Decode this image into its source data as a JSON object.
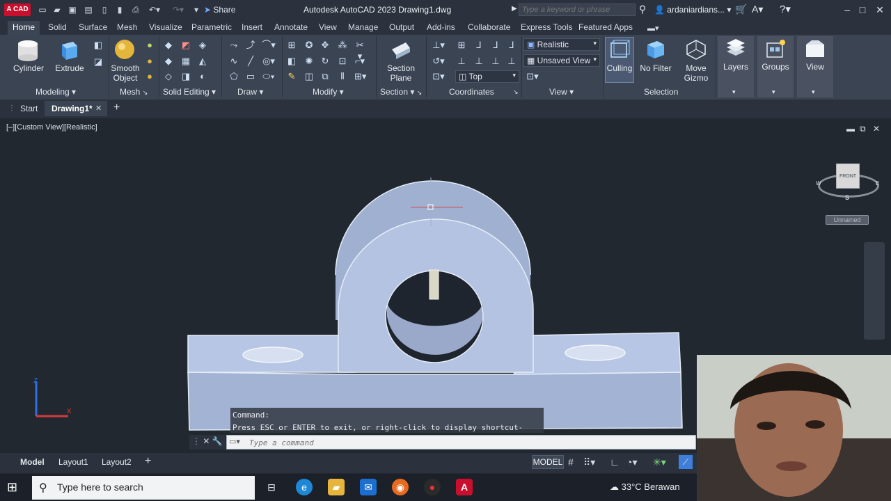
{
  "titlebar": {
    "logo": "A CAD",
    "share": "Share",
    "title": "Autodesk AutoCAD 2023    Drawing1.dwg",
    "search_placeholder": "Type a keyword or phrase",
    "user": "ardaniardians..."
  },
  "tabs": [
    "Home",
    "Solid",
    "Surface",
    "Mesh",
    "Visualize",
    "Parametric",
    "Insert",
    "Annotate",
    "View",
    "Manage",
    "Output",
    "Add-ins",
    "Collaborate",
    "Express Tools",
    "Featured Apps"
  ],
  "ribbon": {
    "cylinder": "Cylinder",
    "extrude": "Extrude",
    "smooth_object": "Smooth\nObject",
    "section_plane": "Section\nPlane",
    "visual_style": "Realistic",
    "view_name": "Unsaved View",
    "ucs_view": "Top",
    "culling": "Culling",
    "no_filter": "No Filter",
    "move_gizmo": "Move\nGizmo",
    "layers": "Layers",
    "groups": "Groups",
    "view": "View",
    "panels": [
      "Modeling",
      "Mesh",
      "Solid Editing",
      "Draw",
      "Modify",
      "Section",
      "Coordinates",
      "View",
      "Selection"
    ]
  },
  "filetabs": {
    "start": "Start",
    "drawing": "Drawing1*"
  },
  "viewport": {
    "label": "[–][Custom View][Realistic]",
    "cube_face": "FRONT",
    "cube_w": "W",
    "cube_e": "E",
    "cube_s": "S",
    "named_view": "Unnamed"
  },
  "command": {
    "history_1": "Command:",
    "history_2": "Press ESC or ENTER to exit, or right-click to display shortcut-menu.",
    "placeholder": "Type a command"
  },
  "layout_tabs": [
    "Model",
    "Layout1",
    "Layout2"
  ],
  "status": {
    "model": "MODEL"
  },
  "taskbar": {
    "search_placeholder": "Type here to search",
    "weather": "33°C  Berawan"
  }
}
